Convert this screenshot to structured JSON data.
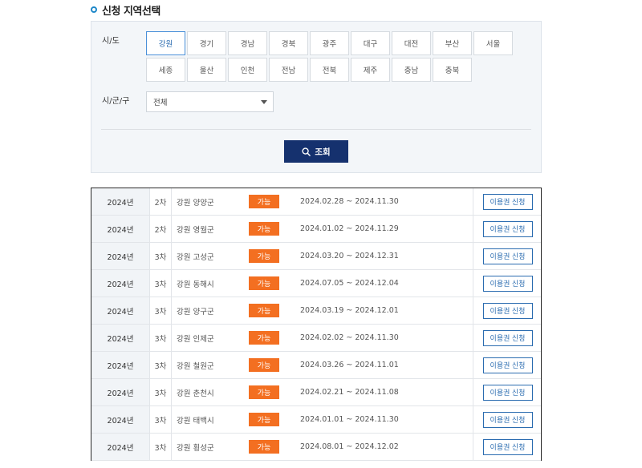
{
  "section": {
    "title": "신청 지역선택"
  },
  "filter": {
    "sido_label": "시/도",
    "sigungu_label": "시/군/구",
    "regions": [
      "강원",
      "경기",
      "경남",
      "경북",
      "광주",
      "대구",
      "대전",
      "부산",
      "서울",
      "세종",
      "울산",
      "인천",
      "전남",
      "전북",
      "제주",
      "충남",
      "충북"
    ],
    "active_region": "강원",
    "sigungu_selected": "전체",
    "search_label": "조회"
  },
  "table": {
    "rows": [
      {
        "year": "2024년",
        "round": "2차",
        "region": "강원 양양군",
        "status": "가능",
        "period": "2024.02.28 ~ 2024.11.30",
        "action": "이용권 신청"
      },
      {
        "year": "2024년",
        "round": "2차",
        "region": "강원 영월군",
        "status": "가능",
        "period": "2024.01.02 ~ 2024.11.29",
        "action": "이용권 신청"
      },
      {
        "year": "2024년",
        "round": "3차",
        "region": "강원 고성군",
        "status": "가능",
        "period": "2024.03.20 ~ 2024.12.31",
        "action": "이용권 신청"
      },
      {
        "year": "2024년",
        "round": "3차",
        "region": "강원 동해시",
        "status": "가능",
        "period": "2024.07.05 ~ 2024.12.04",
        "action": "이용권 신청"
      },
      {
        "year": "2024년",
        "round": "3차",
        "region": "강원 양구군",
        "status": "가능",
        "period": "2024.03.19 ~ 2024.12.01",
        "action": "이용권 신청"
      },
      {
        "year": "2024년",
        "round": "3차",
        "region": "강원 인제군",
        "status": "가능",
        "period": "2024.02.02 ~ 2024.11.30",
        "action": "이용권 신청"
      },
      {
        "year": "2024년",
        "round": "3차",
        "region": "강원 철원군",
        "status": "가능",
        "period": "2024.03.26 ~ 2024.11.01",
        "action": "이용권 신청"
      },
      {
        "year": "2024년",
        "round": "3차",
        "region": "강원 춘천시",
        "status": "가능",
        "period": "2024.02.21 ~ 2024.11.08",
        "action": "이용권 신청"
      },
      {
        "year": "2024년",
        "round": "3차",
        "region": "강원 태백시",
        "status": "가능",
        "period": "2024.01.01 ~ 2024.11.30",
        "action": "이용권 신청"
      },
      {
        "year": "2024년",
        "round": "3차",
        "region": "강원 횡성군",
        "status": "가능",
        "period": "2024.08.01 ~ 2024.12.02",
        "action": "이용권 신청"
      }
    ]
  },
  "colors": {
    "accent_navy": "#15316e",
    "status_orange": "#f36f21",
    "link_blue": "#2b6cb0",
    "title_dot": "#1e88c9"
  },
  "icons": {
    "title_marker": "circle-dot-icon",
    "search": "search-icon",
    "dropdown": "chevron-down-icon"
  }
}
